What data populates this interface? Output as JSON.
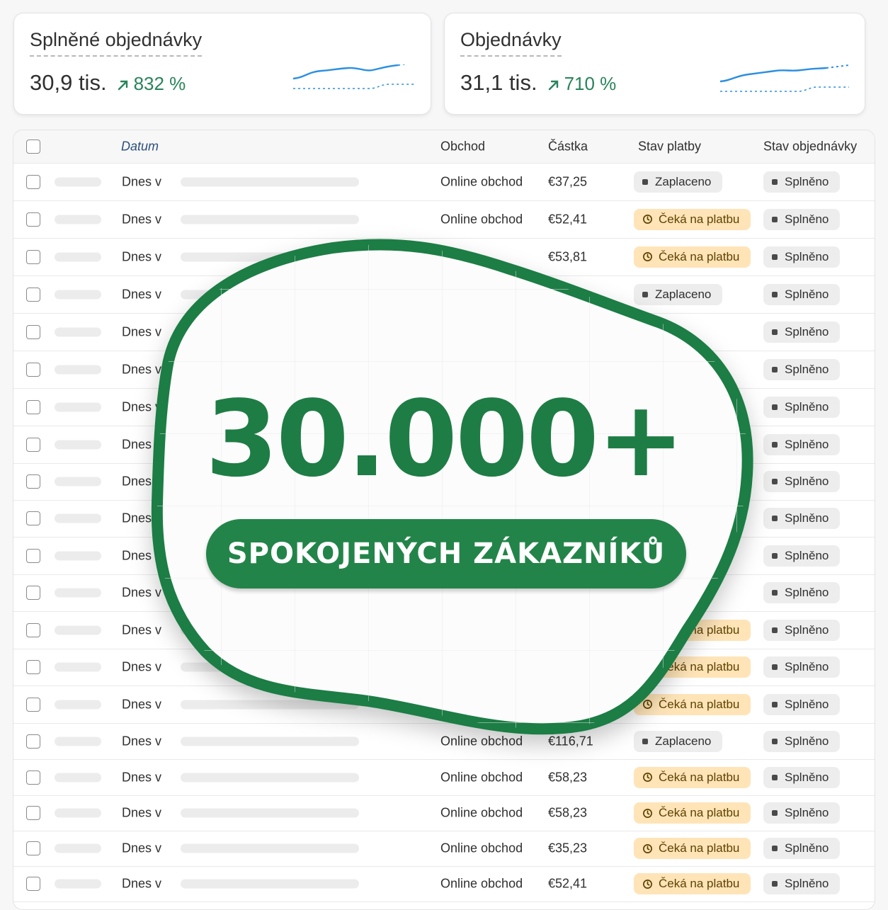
{
  "cards": [
    {
      "title": "Splněné objednávky",
      "value": "30,9 tis.",
      "change": "832 %"
    },
    {
      "title": "Objednávky",
      "value": "31,1 tis.",
      "change": "710 %"
    }
  ],
  "table": {
    "headers": {
      "date": "Datum",
      "shop": "Obchod",
      "amount": "Částka",
      "payment": "Stav platby",
      "order": "Stav objednávky"
    },
    "rows": [
      {
        "date": "Dnes v",
        "shop": "Online obchod",
        "amount": "€37,25",
        "payment": "Zaplaceno",
        "payment_type": "paid",
        "order": "Splněno"
      },
      {
        "date": "Dnes v",
        "shop": "Online obchod",
        "amount": "€52,41",
        "payment": "Čeká na platbu",
        "payment_type": "wait",
        "order": "Splněno"
      },
      {
        "date": "Dnes v",
        "shop": "",
        "amount": "€53,81",
        "payment": "Čeká na platbu",
        "payment_type": "wait",
        "order": "Splněno"
      },
      {
        "date": "Dnes v",
        "shop": "",
        "amount": "",
        "payment": "Zaplaceno",
        "payment_type": "paid",
        "order": "Splněno"
      },
      {
        "date": "Dnes v",
        "shop": "",
        "amount": "",
        "payment": "",
        "payment_type": "",
        "order": "Splněno"
      },
      {
        "date": "Dnes v",
        "shop": "",
        "amount": "",
        "payment": "",
        "payment_type": "",
        "order": "Splněno"
      },
      {
        "date": "Dnes v",
        "shop": "",
        "amount": "",
        "payment": "",
        "payment_type": "",
        "order": "Splněno"
      },
      {
        "date": "Dnes v",
        "shop": "",
        "amount": "",
        "payment": "",
        "payment_type": "",
        "order": "Splněno"
      },
      {
        "date": "Dnes",
        "shop": "",
        "amount": "",
        "payment": "",
        "payment_type": "",
        "order": "Splněno"
      },
      {
        "date": "Dnes",
        "shop": "",
        "amount": "",
        "payment": "",
        "payment_type": "",
        "order": "Splněno"
      },
      {
        "date": "Dnes v",
        "shop": "",
        "amount": "",
        "payment": "",
        "payment_type": "",
        "order": "Splněno"
      },
      {
        "date": "Dnes v",
        "shop": "",
        "amount": "",
        "payment": "",
        "payment_type": "",
        "order": "Splněno"
      },
      {
        "date": "Dnes v",
        "shop": "",
        "amount": "",
        "payment": "Čeká na platbu",
        "payment_type": "wait",
        "order": "Splněno"
      },
      {
        "date": "Dnes v",
        "shop": "",
        "amount": "",
        "payment": "Čeká na platbu",
        "payment_type": "wait",
        "order": "Splněno"
      },
      {
        "date": "Dnes v",
        "shop": "",
        "amount": "",
        "payment": "Čeká na platbu",
        "payment_type": "wait",
        "order": "Splněno"
      },
      {
        "date": "Dnes v",
        "shop": "Online obchod",
        "amount": "€116,71",
        "payment": "Zaplaceno",
        "payment_type": "paid",
        "order": "Splněno"
      },
      {
        "date": "Dnes v",
        "shop": "Online obchod",
        "amount": "€58,23",
        "payment": "Čeká na platbu",
        "payment_type": "wait",
        "order": "Splněno"
      },
      {
        "date": "Dnes v",
        "shop": "Online obchod",
        "amount": "€58,23",
        "payment": "Čeká na platbu",
        "payment_type": "wait",
        "order": "Splněno"
      },
      {
        "date": "Dnes v",
        "shop": "Online obchod",
        "amount": "€35,23",
        "payment": "Čeká na platbu",
        "payment_type": "wait",
        "order": "Splněno"
      },
      {
        "date": "Dnes v",
        "shop": "Online obchod",
        "amount": "€52,41",
        "payment": "Čeká na platbu",
        "payment_type": "wait",
        "order": "Splněno"
      }
    ]
  },
  "promo": {
    "number": "30.000+",
    "label": "SPOKOJENÝCH ZÁKAZNÍKŮ"
  },
  "colors": {
    "accent_green": "#1e7d45",
    "pending_badge": "#ffe4b8",
    "neutral_badge": "#ededed",
    "positive_change": "#29845a",
    "sparkline": "#2b8fe0"
  }
}
